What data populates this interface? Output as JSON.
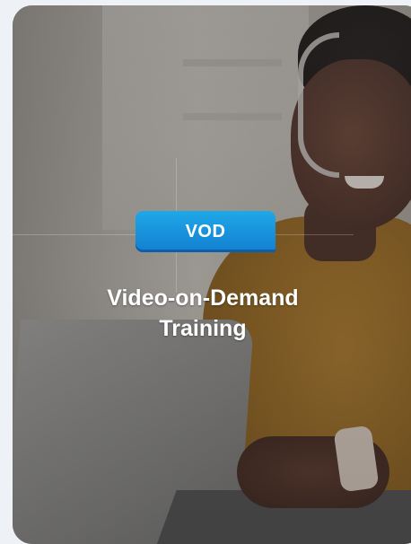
{
  "card": {
    "badge_label": "VOD",
    "title_line1": "Video-on-Demand",
    "title_line2": "Training"
  },
  "colors": {
    "badge": "#1a94dc",
    "title_text": "#ffffff",
    "page_background": "#eef1f5"
  }
}
